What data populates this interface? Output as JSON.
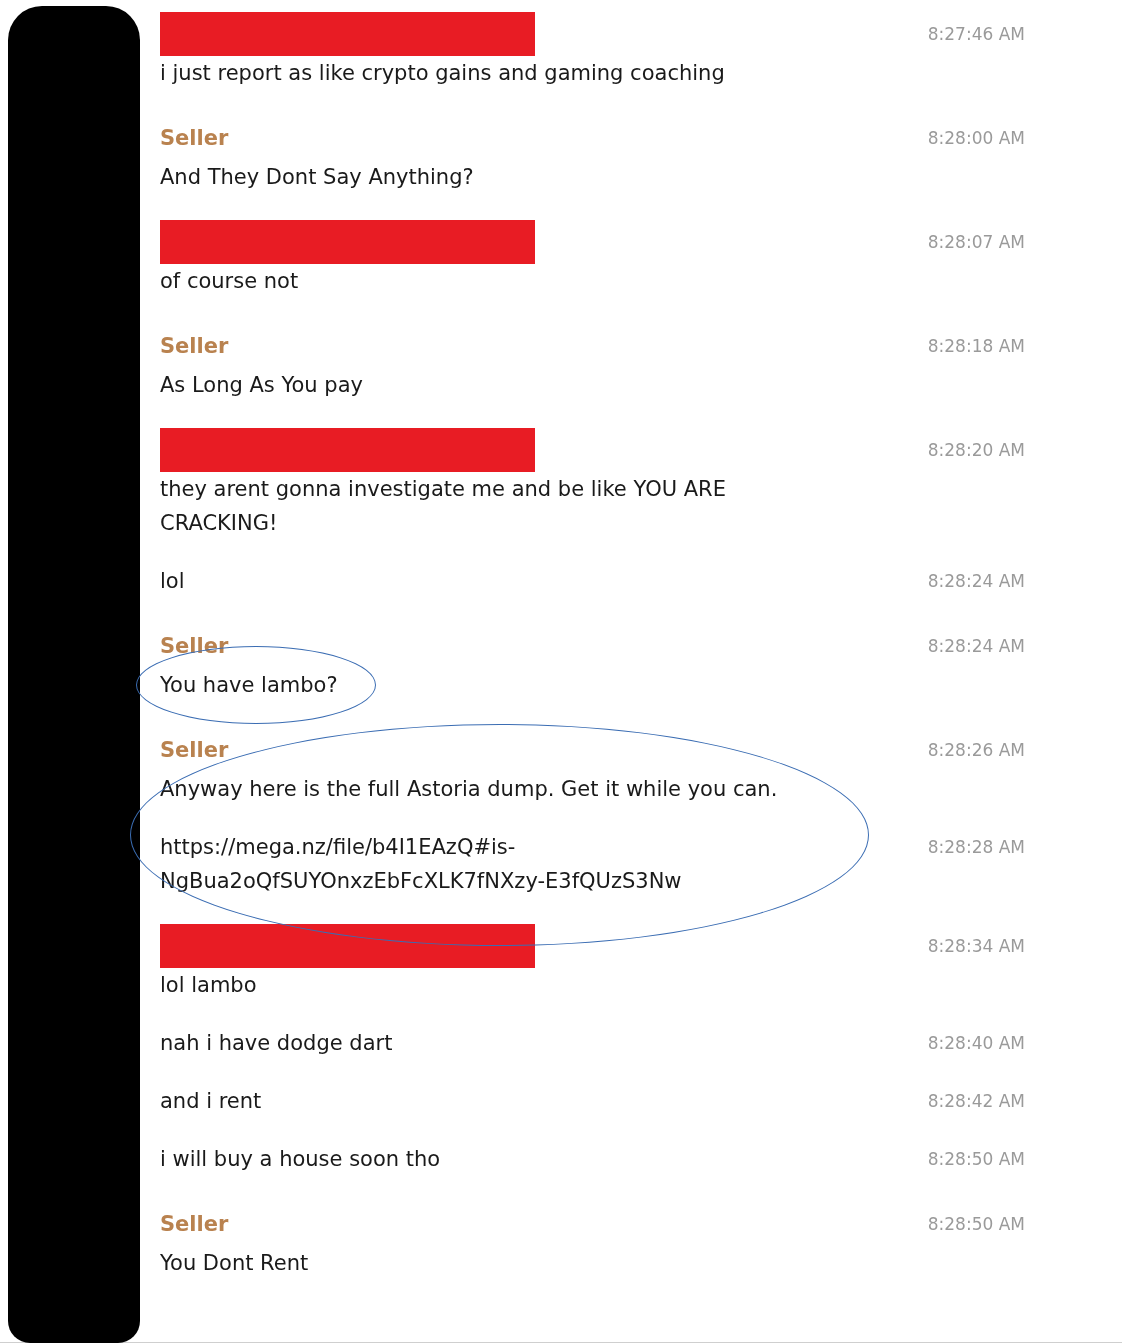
{
  "groups": [
    {
      "sender": {
        "kind": "redacted"
      },
      "time": "8:27:46 AM",
      "messages": [
        {
          "text": "i just report as like crypto gains and gaming coaching"
        }
      ]
    },
    {
      "sender": {
        "kind": "named",
        "name": "Seller"
      },
      "time": "8:28:00 AM",
      "messages": [
        {
          "text": "And They Dont Say Anything?"
        }
      ]
    },
    {
      "sender": {
        "kind": "redacted"
      },
      "time": "8:28:07 AM",
      "messages": [
        {
          "text": "of course not"
        }
      ]
    },
    {
      "sender": {
        "kind": "named",
        "name": "Seller"
      },
      "time": "8:28:18 AM",
      "messages": [
        {
          "text": "As Long As You pay"
        }
      ]
    },
    {
      "sender": {
        "kind": "redacted"
      },
      "time": "8:28:20 AM",
      "messages": [
        {
          "text": "they arent gonna investigate me and be like YOU ARE CRACKING!"
        },
        {
          "text": "lol",
          "time": "8:28:24 AM"
        }
      ]
    },
    {
      "sender": {
        "kind": "named",
        "name": "Seller"
      },
      "time": "8:28:24 AM",
      "circled": true,
      "messages": [
        {
          "text": "You have lambo?"
        }
      ]
    },
    {
      "sender": {
        "kind": "named",
        "name": "Seller"
      },
      "time": "8:28:26 AM",
      "circled": true,
      "messages": [
        {
          "text": "Anyway here is the full Astoria dump. Get it while you can."
        },
        {
          "text": "https://mega.nz/file/b4I1EAzQ#is-NgBua2oQfSUYOnxzEbFcXLK7fNXzy-E3fQUzS3Nw",
          "time": "8:28:28 AM"
        }
      ]
    },
    {
      "sender": {
        "kind": "redacted"
      },
      "time": "8:28:34 AM",
      "messages": [
        {
          "text": "lol lambo"
        },
        {
          "text": "nah i have dodge dart",
          "time": "8:28:40 AM"
        },
        {
          "text": "and i rent",
          "time": "8:28:42 AM"
        },
        {
          "text": "i will buy a house soon tho",
          "time": "8:28:50 AM"
        }
      ]
    },
    {
      "sender": {
        "kind": "named",
        "name": "Seller"
      },
      "time": "8:28:50 AM",
      "messages": [
        {
          "text": "You Dont Rent"
        }
      ]
    }
  ]
}
